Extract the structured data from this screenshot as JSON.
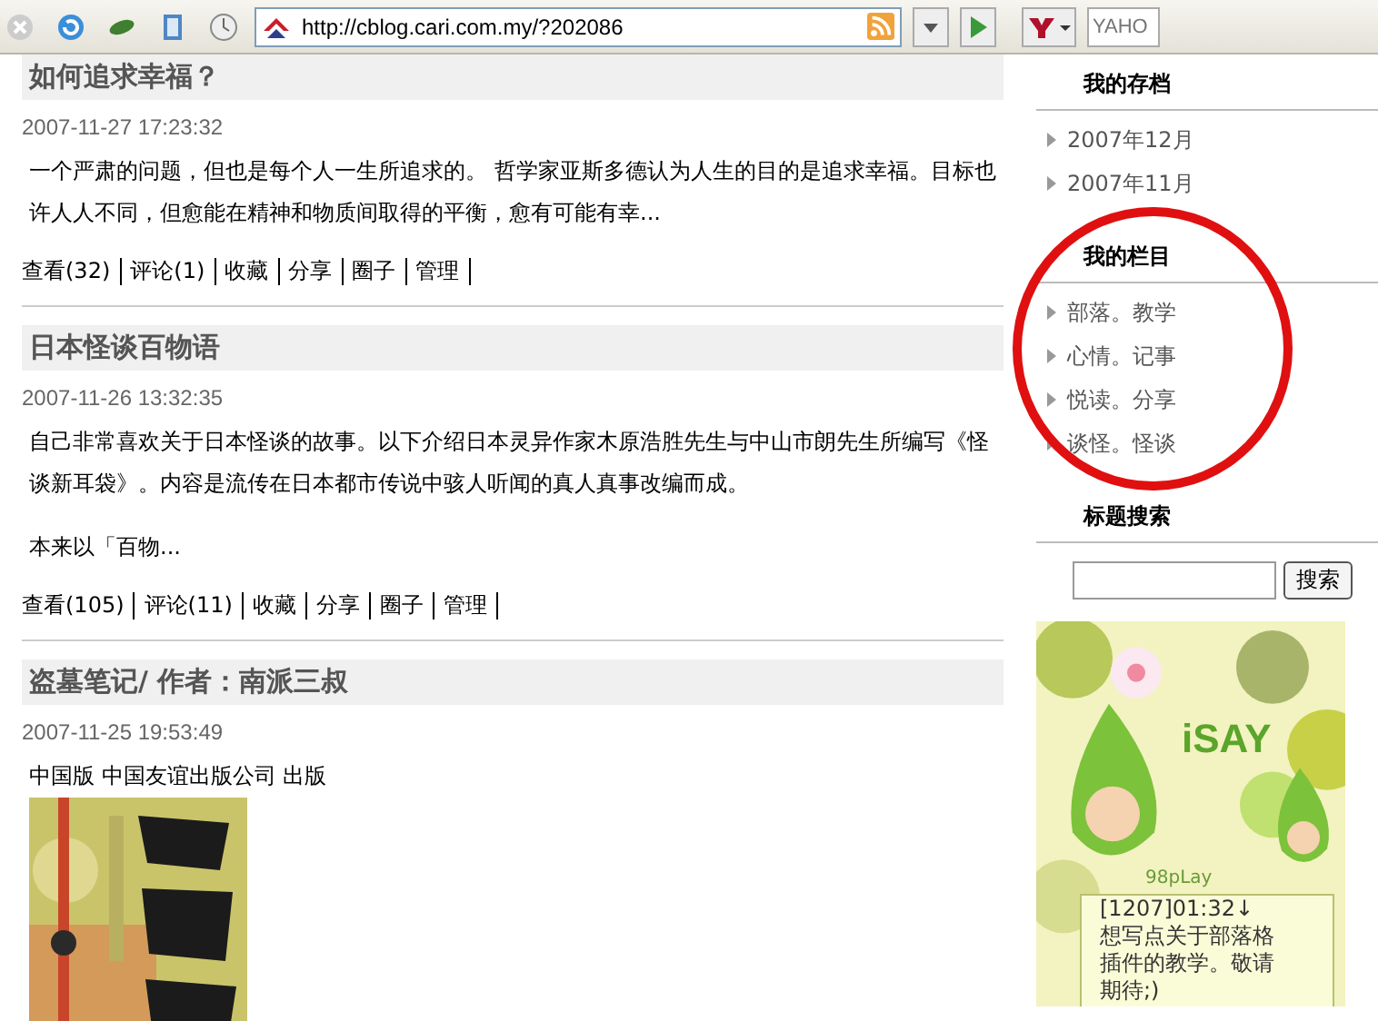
{
  "toolbar": {
    "address": "http://cblog.cari.com.my/?202086",
    "search_placeholder": "YAHO"
  },
  "posts": [
    {
      "title": "如何追求幸福？",
      "date": "2007-11-27 17:23:32",
      "blocks": [
        {
          "kind": "text",
          "text": "一个严肃的问题，但也是每个人一生所追求的。  哲学家亚斯多德认为人生的目的是追求幸福。目标也许人人不同，但愈能在精神和物质间取得的平衡，愈有可能有幸..."
        }
      ],
      "actions": [
        "查看(32)",
        "评论(1)",
        "收藏",
        "分享",
        "圈子",
        "管理"
      ]
    },
    {
      "title": "日本怪谈百物语",
      "date": "2007-11-26 13:32:35",
      "blocks": [
        {
          "kind": "text",
          "text": "自己非常喜欢关于日本怪谈的故事。以下介绍日本灵异作家木原浩胜先生与中山市朗先生所编写《怪谈新耳袋》。内容是流传在日本都市传说中骇人听闻的真人真事改编而成。"
        },
        {
          "kind": "text",
          "text": "本来以「百物..."
        }
      ],
      "actions": [
        "查看(105)",
        "评论(11)",
        "收藏",
        "分享",
        "圈子",
        "管理"
      ]
    },
    {
      "title": "盗墓笔记/ 作者：南派三叔",
      "date": "2007-11-25 19:53:49",
      "blocks": [
        {
          "kind": "text",
          "text": "中国版  中国友谊出版公司 出版"
        },
        {
          "kind": "picture"
        }
      ]
    }
  ],
  "sidebar": {
    "sections": [
      {
        "title": "我的存档",
        "items": [
          "2007年12月",
          "2007年11月"
        ]
      },
      {
        "title": "我的栏目",
        "items": [
          "部落。教学",
          "心情。记事",
          "悦读。分享",
          "谈怪。怪谈"
        ]
      }
    ],
    "search": {
      "title": "标题搜索",
      "button": "搜索"
    },
    "widget": {
      "brand": "iSAY",
      "sub": "98pLay",
      "message": [
        "[1207]01:32↓",
        "想写点关于部落格",
        "插件的教学。敬请",
        "期待;)"
      ]
    }
  }
}
